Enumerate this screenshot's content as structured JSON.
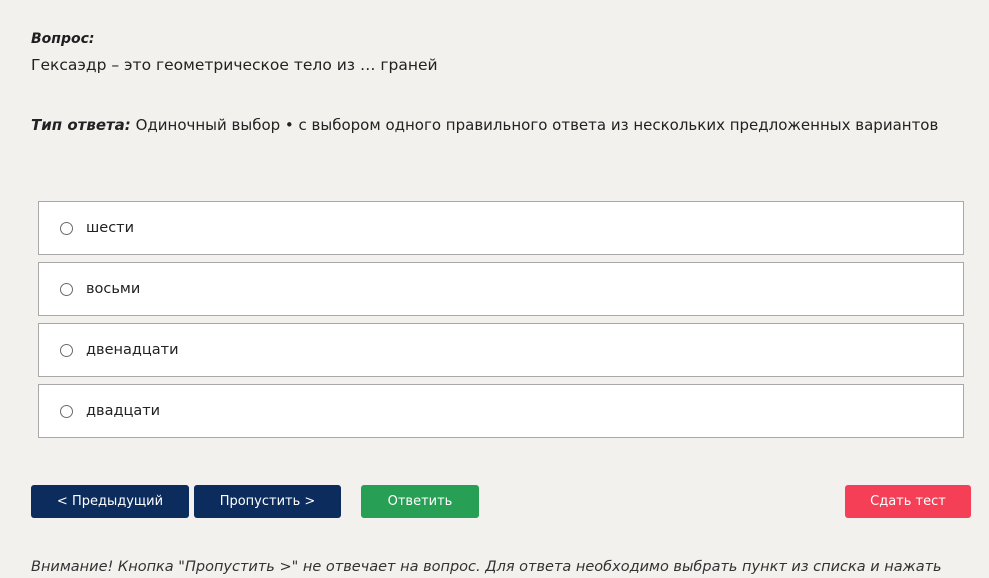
{
  "question": {
    "label": "Вопрос:",
    "text": "Гексаэдр – это геометрическое тело из … граней"
  },
  "answer_type": {
    "label": "Тип ответа:",
    "value": " Одиночный выбор • с выбором одного правильного ответа из нескольких предложенных вариантов"
  },
  "options": [
    {
      "label": "шести",
      "selected": false
    },
    {
      "label": "восьми",
      "selected": false
    },
    {
      "label": "двенадцати",
      "selected": false
    },
    {
      "label": "двадцати",
      "selected": false
    }
  ],
  "buttons": {
    "prev": "< Предыдущий",
    "skip": "Пропустить >",
    "answer": "Ответить",
    "submit": "Сдать тест"
  },
  "notice": "Внимание! Кнопка \"Пропустить >\" не отвечает на вопрос. Для ответа необходимо выбрать пункт из списка и нажать",
  "colors": {
    "background": "#f2f1ee",
    "primary_button": "#0c2c5e",
    "answer_button": "#27a055",
    "submit_button": "#f43f57"
  }
}
